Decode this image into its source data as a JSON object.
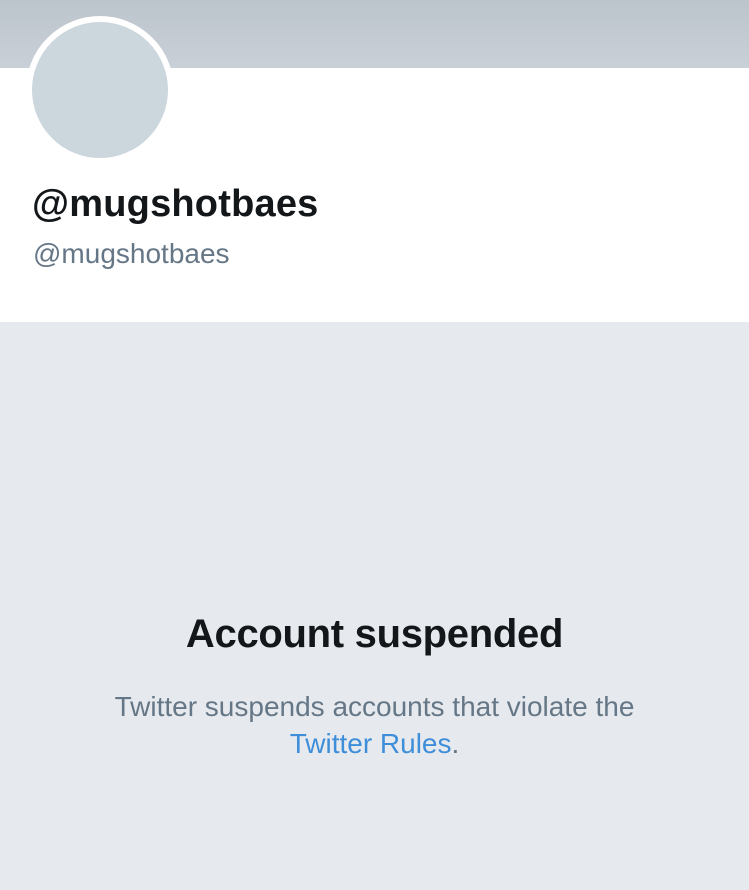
{
  "profile": {
    "display_name": "@mugshotbaes",
    "handle": "@mugshotbaes"
  },
  "suspension": {
    "title": "Account suspended",
    "message": "Twitter suspends accounts that violate the",
    "rules_link": "Twitter Rules",
    "trailing": "."
  },
  "colors": {
    "banner": "#bcc4cc",
    "avatar": "#ccd6dd",
    "text_primary": "#14171a",
    "text_secondary": "#657786",
    "link": "#3f8ed9",
    "background": "#e6e9ed"
  }
}
